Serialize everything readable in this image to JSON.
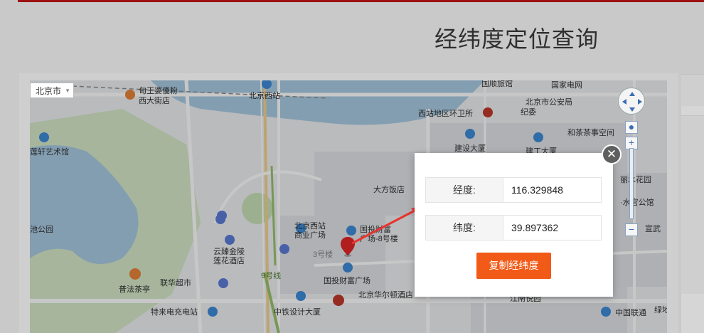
{
  "page": {
    "title": "经纬度定位查询"
  },
  "map": {
    "city": "北京市",
    "labels": [
      "北京西站",
      "国家电网",
      "北京市公安局纪委",
      "西站地区环卫所",
      "建设大厦",
      "和茶茶事空间",
      "大方饭店",
      "北京西站商业广场",
      "国投财富广场-8号楼",
      "云臻金陵莲花酒店",
      "联华超市",
      "普法茶亭",
      "特来电充电站",
      "国投财富广场",
      "北京华尔顿酒店",
      "中铁设计大厦",
      "江南悦园",
      "中国联通",
      "丽水嘉园",
      "花园",
      "3号楼",
      "9号线",
      "莲轩艺术馆",
      "池公园",
      "甸王婆傻粉西大街店",
      "国顺旅馆",
      "建工大厦",
      "丽水花园宫",
      "宣武文",
      "绿地"
    ]
  },
  "modal": {
    "longitude_label": "经度:",
    "longitude_value": "116.329848",
    "latitude_label": "纬度:",
    "latitude_value": "39.897362",
    "copy_button": "复制经纬度",
    "close_glyph": "✕"
  },
  "colors": {
    "accent": "#f15a17",
    "topbar": "#9e1010",
    "arrow": "#e8332e"
  }
}
